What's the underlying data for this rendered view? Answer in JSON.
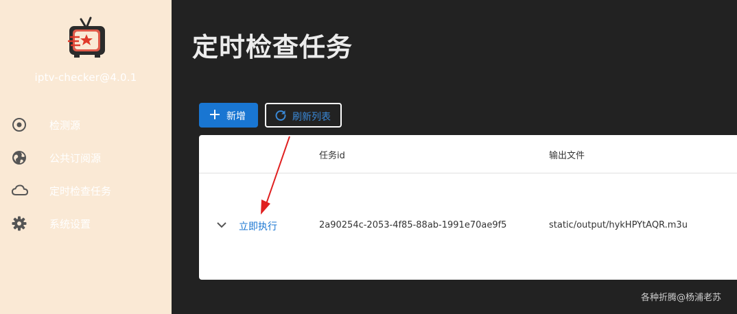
{
  "sidebar": {
    "version": "iptv-checker@4.0.1",
    "items": [
      {
        "label": "检测源",
        "icon": "radio-target-icon"
      },
      {
        "label": "公共订阅源",
        "icon": "globe-icon"
      },
      {
        "label": "定时检查任务",
        "icon": "cloud-icon"
      },
      {
        "label": "系统设置",
        "icon": "gear-icon"
      }
    ]
  },
  "main": {
    "title": "定时检查任务",
    "toolbar": {
      "add_label": "新增",
      "refresh_label": "刷新列表"
    },
    "table": {
      "headers": [
        "任务id",
        "输出文件"
      ],
      "rows": [
        {
          "action": "立即执行",
          "task_id": "2a90254c-2053-4f85-88ab-1991e70ae9f5",
          "output_file": "static/output/hykHPYtAQR.m3u"
        }
      ]
    }
  },
  "watermark": "各种折腾@杨浦老苏",
  "colors": {
    "sidebar_bg": "#fae9d5",
    "main_bg": "#222222",
    "accent": "#1976d2",
    "arrow": "#e02020"
  }
}
